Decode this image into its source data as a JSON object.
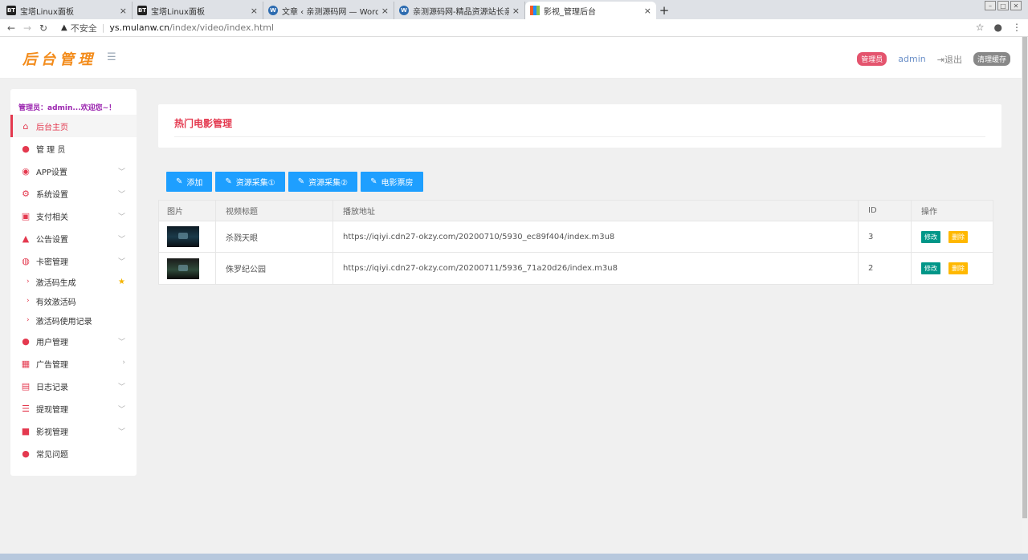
{
  "browser": {
    "tabs": [
      {
        "title": "宝塔Linux面板",
        "favicon": "bt-icon"
      },
      {
        "title": "宝塔Linux面板",
        "favicon": "bt-icon"
      },
      {
        "title": "文章 ‹ 亲测源码网 — WordPress",
        "favicon": "wordpress-icon"
      },
      {
        "title": "亲测源码网-精品资源站长亲测",
        "favicon": "wordpress-icon"
      },
      {
        "title": "影视_管理后台",
        "favicon": "site-icon"
      }
    ],
    "insecure": "不安全",
    "url_host": "ys.mulanw.cn",
    "url_path": "/index/video/index.html"
  },
  "header": {
    "logo": "后台管理",
    "role_badge": "管理员",
    "username": "admin",
    "logout": "退出",
    "clear_cache": "清理缓存"
  },
  "sidebar": {
    "welcome": "管理员：admin...欢迎您~！",
    "items": [
      {
        "label": "后台主页",
        "icon": "home-icon",
        "active": true
      },
      {
        "label": "管 理 员",
        "icon": "user-icon"
      },
      {
        "label": "APP设置",
        "icon": "soccer-icon",
        "arrow": "down"
      },
      {
        "label": "系统设置",
        "icon": "gears-icon",
        "arrow": "down"
      },
      {
        "label": "支付相关",
        "icon": "money-icon",
        "arrow": "down"
      },
      {
        "label": "公告设置",
        "icon": "bell-icon",
        "arrow": "down"
      },
      {
        "label": "卡密管理",
        "icon": "globe-icon",
        "arrow": "down"
      }
    ],
    "subitems": [
      {
        "label": "激活码生成",
        "star": true
      },
      {
        "label": "有效激活码"
      },
      {
        "label": "激活码使用记录"
      }
    ],
    "items2": [
      {
        "label": "用户管理",
        "icon": "users-icon",
        "arrow": "down"
      },
      {
        "label": "广告管理",
        "icon": "table-icon",
        "arrow": "right"
      },
      {
        "label": "日志记录",
        "icon": "printer-icon",
        "arrow": "down"
      },
      {
        "label": "提现管理",
        "icon": "list-icon",
        "arrow": "down"
      },
      {
        "label": "影视管理",
        "icon": "video-icon",
        "arrow": "down"
      },
      {
        "label": "常见问题",
        "icon": "user-icon"
      }
    ]
  },
  "page": {
    "title": "热门电影管理",
    "buttons": [
      "添加",
      "资源采集①",
      "资源采集②",
      "电影票房"
    ],
    "columns": [
      "图片",
      "视频标题",
      "播放地址",
      "ID",
      "操作"
    ],
    "rows": [
      {
        "title": "杀戮天眼",
        "url": "https://iqiyi.cdn27-okzy.com/20200710/5930_ec89f404/index.m3u8",
        "id": "3"
      },
      {
        "title": "侏罗纪公园",
        "url": "https://iqiyi.cdn27-okzy.com/20200711/5936_71a20d26/index.m3u8",
        "id": "2"
      }
    ],
    "edit_label": "修改",
    "delete_label": "删除"
  },
  "colors": {
    "accent": "#e4394f",
    "button": "#1e9fff",
    "edit": "#009688",
    "delete": "#ffb800"
  }
}
